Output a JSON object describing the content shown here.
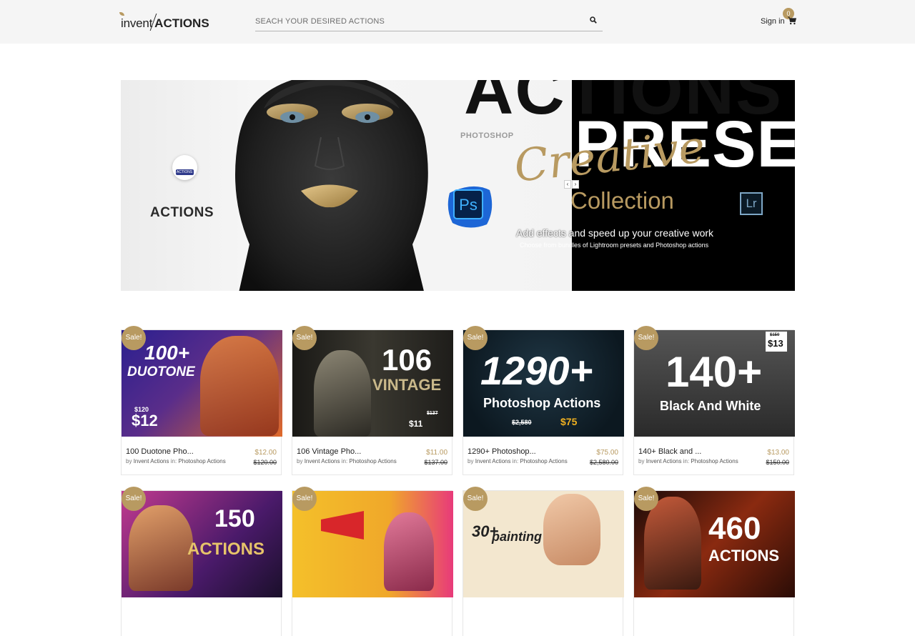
{
  "header": {
    "logo": {
      "part1": "invent",
      "part2": "ACTIONS"
    },
    "search": {
      "placeholder": "SEACH YOUR DESIRED ACTIONS",
      "value": ""
    },
    "sign_in": "Sign in",
    "cart_count": "0"
  },
  "banner": {
    "headline_top": "ACTIONS",
    "headline_right": "PRESE",
    "script_word": "Creative",
    "photoshop_label": "PHOTOSHOP",
    "collection": "Collection",
    "tagline": "Add effects and speed up your creative work",
    "subline": "Choose from bundles of Lightroom presets and Photoshop actions",
    "left_label": "ACTIONS",
    "badge_label": "ACTIONS",
    "ps_label": "Ps",
    "lr_label": "Lr",
    "nav_prev": "‹",
    "nav_next": "›"
  },
  "products": [
    {
      "sale": "Sale!",
      "thumb_main": "100+",
      "thumb_sub": "DUOTONE",
      "thumb_old": "$120",
      "thumb_new": "$12",
      "title": "100 Duotone Pho...",
      "by": "by",
      "author": "Invent Actions",
      "in": "in:",
      "category": "Photoshop Actions",
      "price": "$12.00",
      "old_price": "$120.00",
      "bg": "#3a2a8a"
    },
    {
      "sale": "Sale!",
      "thumb_main": "106",
      "thumb_sub": "VINTAGE",
      "thumb_old": "$137",
      "thumb_new": "$11",
      "title": "106 Vintage Pho...",
      "by": "by",
      "author": "Invent Actions",
      "in": "in:",
      "category": "Photoshop Actions",
      "price": "$11.00",
      "old_price": "$137.00",
      "bg": "#2b2a26"
    },
    {
      "sale": "Sale!",
      "thumb_main": "1290+",
      "thumb_sub": "Photoshop Actions",
      "thumb_old": "$2,580",
      "thumb_new": "$75",
      "title": "1290+ Photoshop...",
      "by": "by",
      "author": "Invent Actions",
      "in": "in:",
      "category": "Photoshop Actions",
      "price": "$75.00",
      "old_price": "$2,580.00",
      "bg": "#13202a"
    },
    {
      "sale": "Sale!",
      "thumb_main": "140+",
      "thumb_sub": "Black And White",
      "thumb_old": "$150",
      "thumb_new": "$13",
      "title": "140+ Black and ...",
      "by": "by",
      "author": "Invent Actions",
      "in": "in:",
      "category": "Photoshop Actions",
      "price": "$13.00",
      "old_price": "$150.00",
      "bg": "#3a3a3a"
    },
    {
      "sale": "Sale!",
      "thumb_main": "150",
      "thumb_sub": "ACTIONS",
      "bg": "#5a1e6b"
    },
    {
      "sale": "Sale!",
      "thumb_main": "",
      "thumb_sub": "",
      "bg": "#f2c42a"
    },
    {
      "sale": "Sale!",
      "thumb_main": "30+",
      "thumb_sub": "painting",
      "bg": "#f3e7cf"
    },
    {
      "sale": "Sale!",
      "thumb_main": "460",
      "thumb_sub": "ACTIONS",
      "bg": "#7a2410"
    }
  ],
  "colors": {
    "accent": "#b89a61",
    "header_bg": "#f5f5f5"
  }
}
